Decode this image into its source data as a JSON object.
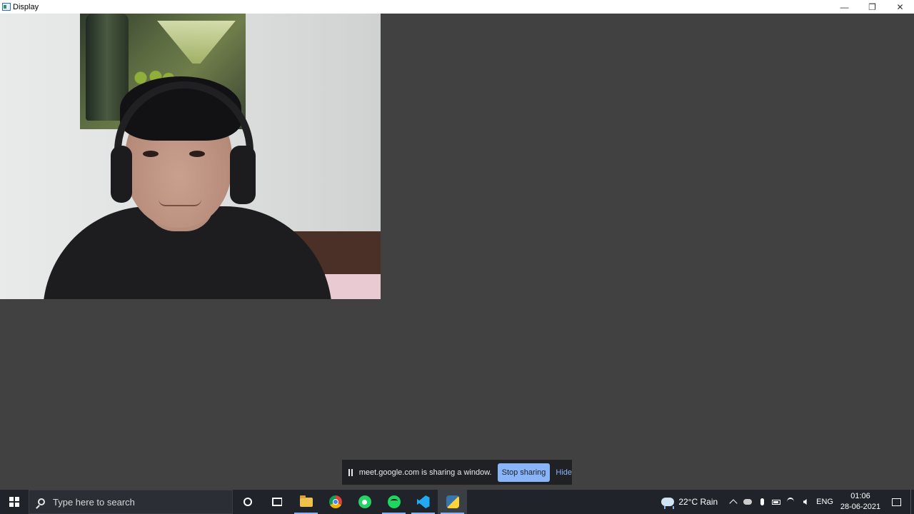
{
  "window": {
    "title": "Display",
    "controls": {
      "minimize": "—",
      "restore": "❐",
      "close": "✕"
    }
  },
  "share_bar": {
    "message": "meet.google.com is sharing a window.",
    "stop_label": "Stop sharing",
    "hide_label": "Hide"
  },
  "taskbar": {
    "search_placeholder": "Type here to search",
    "pinned": [
      "cortana-icon",
      "task-view-icon",
      "file-explorer-icon",
      "chrome-icon",
      "whatsapp-icon",
      "spotify-icon",
      "vscode-icon",
      "python-icon"
    ],
    "weather": "22°C  Rain",
    "language": "ENG",
    "time": "01:06",
    "date": "28-06-2021"
  },
  "colors": {
    "background": "#414141",
    "share_button": "#8ab4f8",
    "taskbar": "#20242a"
  }
}
